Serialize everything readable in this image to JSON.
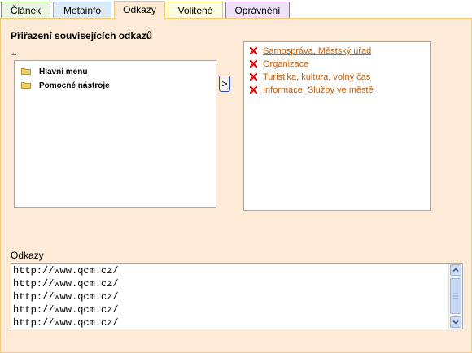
{
  "tabs": [
    {
      "label": "Článek",
      "bg": "#eaf5e3",
      "border": "#6cb043"
    },
    {
      "label": "Metainfo",
      "bg": "#dce9f7",
      "border": "#8fb2dc"
    },
    {
      "label": "Odkazy",
      "bg": "#fdebd8",
      "border": "#f6c97a",
      "active": true
    },
    {
      "label": "Volitené",
      "bg": "#fdfbe1",
      "border": "#e8d050"
    },
    {
      "label": "Oprávnění",
      "bg": "#efe1f7",
      "border": "#a060c8"
    }
  ],
  "related": {
    "heading": "Přiřazení souvisejících odkazů",
    "up_link": "..",
    "tree_items": [
      {
        "label": "Hlavní menu",
        "icon": "folder-icon"
      },
      {
        "label": "Pomocné nástroje",
        "icon": "folder-icon"
      }
    ],
    "move_button": ">",
    "assigned_items": [
      {
        "label": "Samospráva, Městský úřad",
        "icon": "remove-icon"
      },
      {
        "label": "Organizace",
        "icon": "remove-icon"
      },
      {
        "label": "Turistika, kultura, volný čas",
        "icon": "remove-icon"
      },
      {
        "label": "Informace, Služby ve městě",
        "icon": "remove-icon"
      }
    ]
  },
  "links": {
    "heading": "Odkazy",
    "lines": [
      "http://www.qcm.cz/",
      "http://www.qcm.cz/",
      "http://www.qcm.cz/",
      "http://www.qcm.cz/",
      "http://www.qcm.cz/"
    ]
  },
  "colors": {
    "link": "#c06010",
    "panel": "#fdebd8",
    "remove": "#cc1111"
  }
}
